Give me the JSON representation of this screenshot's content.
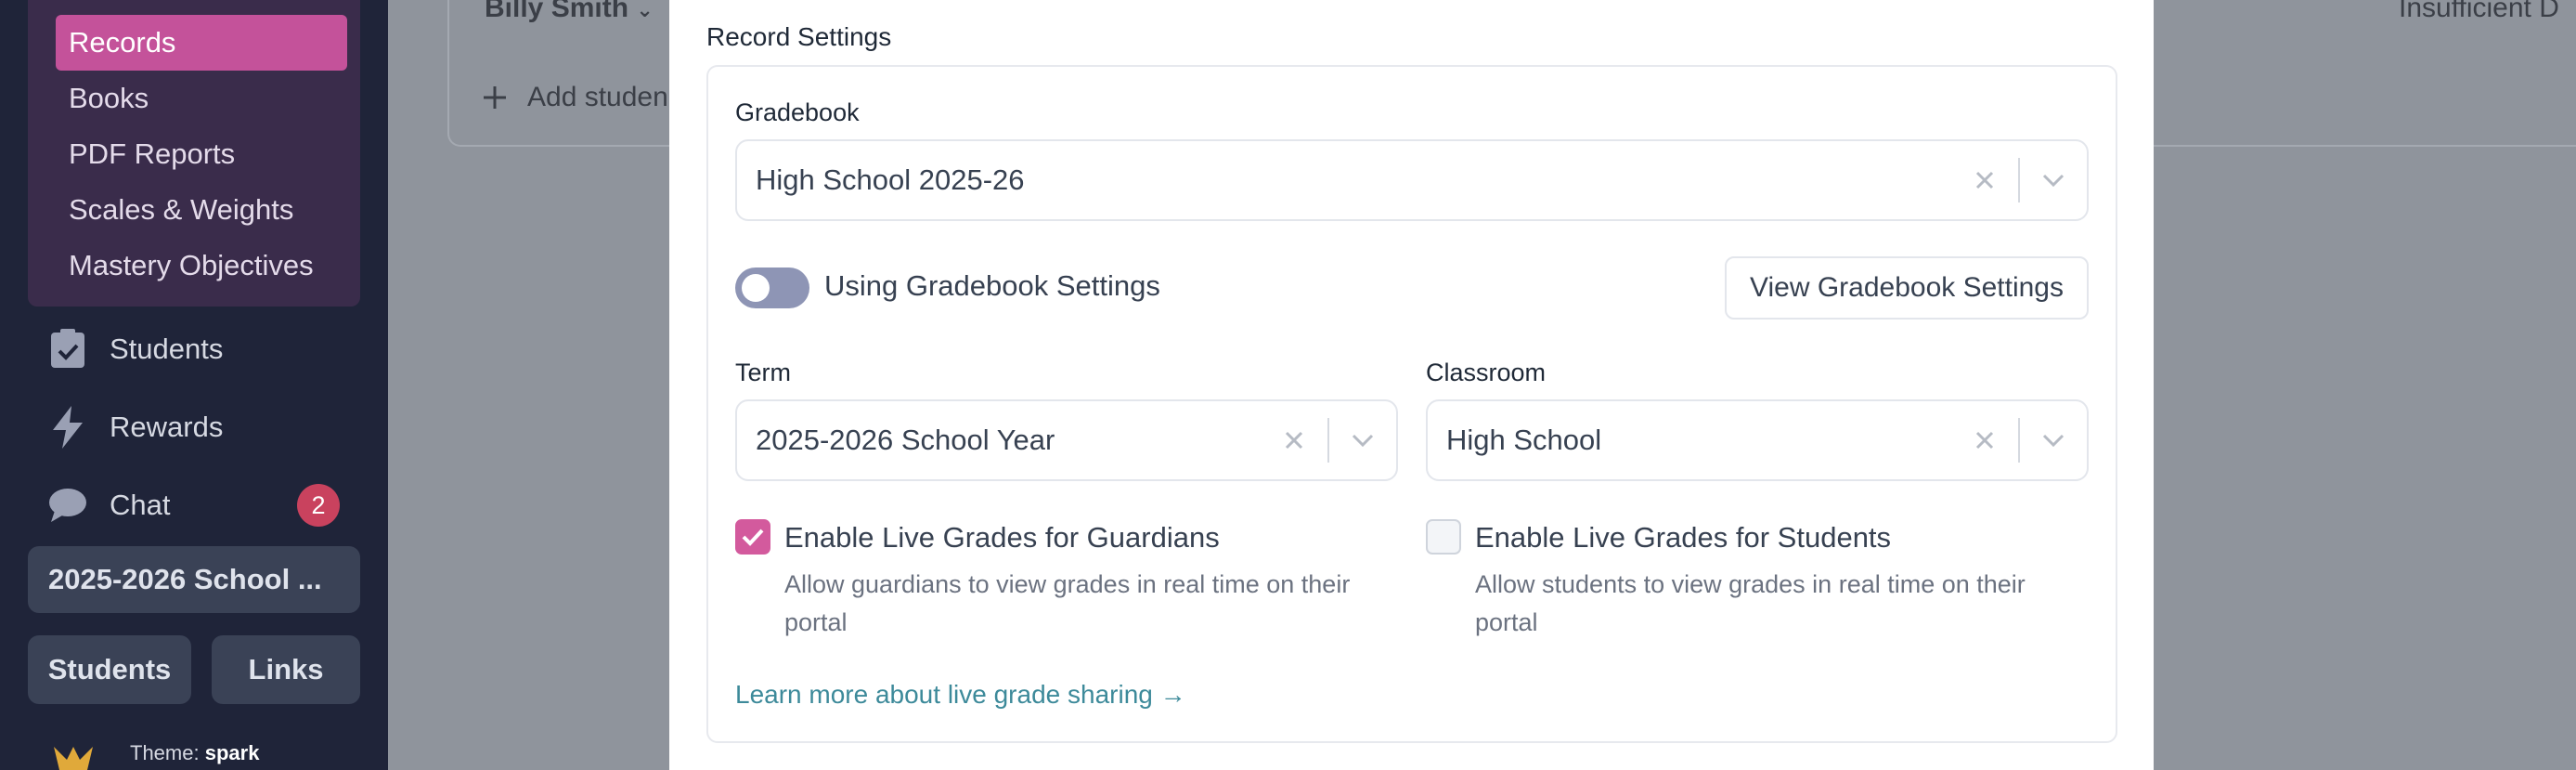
{
  "sidebar": {
    "subnav": [
      "Records",
      "Books",
      "PDF Reports",
      "Scales & Weights",
      "Mastery Objectives"
    ],
    "nav": [
      {
        "label": "Students",
        "icon": "clipboard-check-icon"
      },
      {
        "label": "Rewards",
        "icon": "lightning-icon"
      },
      {
        "label": "Chat",
        "icon": "chat-bubble-icon",
        "badge": "2"
      }
    ],
    "school_year": "2025-2026 School ...",
    "students_button": "Students",
    "links_button": "Links",
    "theme_label": "Theme:",
    "theme_value": "spark"
  },
  "background": {
    "student_name": "Billy Smith",
    "add_student": "Add studen",
    "status_text": "Insufficient D"
  },
  "modal": {
    "section_title": "Record Settings",
    "gradebook_label": "Gradebook",
    "gradebook_value": "High School 2025-26",
    "toggle_label": "Using Gradebook Settings",
    "view_settings_button": "View Gradebook Settings",
    "term_label": "Term",
    "term_value": "2025-2026 School Year",
    "classroom_label": "Classroom",
    "classroom_value": "High School",
    "guardians_label": "Enable Live Grades for Guardians",
    "guardians_help_1": "Allow guardians to view grades in real time on their",
    "guardians_help_2": "portal",
    "students_label": "Enable Live Grades for Students",
    "students_help_1": "Allow students to view grades in real time on their",
    "students_help_2": "portal",
    "learn_more": "Learn more about live grade sharing →"
  },
  "colors": {
    "accent": "#c4529a",
    "sidebar_bg": "#1f2439",
    "link": "#3d8a9a",
    "badge": "#c9425e"
  }
}
